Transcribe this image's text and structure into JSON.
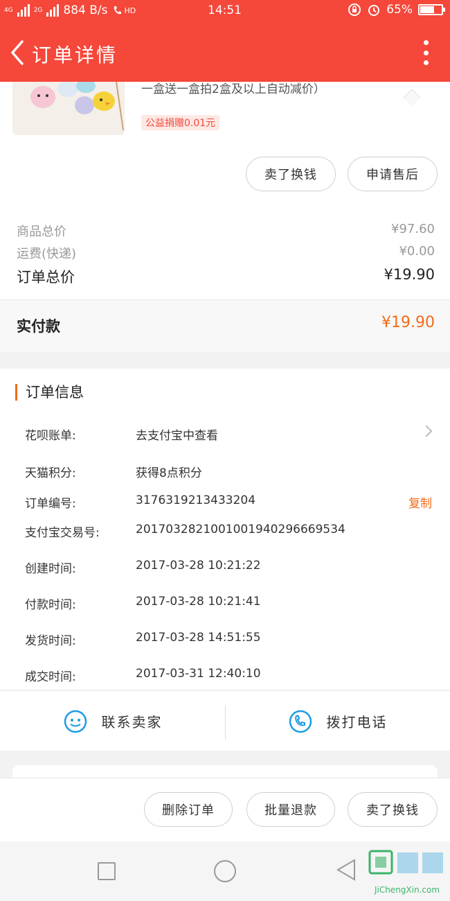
{
  "status_bar": {
    "net1": "4G",
    "net2": "2G",
    "speed": "884 B/s",
    "hd": "HD",
    "time": "14:51",
    "battery": "65%",
    "battery_level": 0.65
  },
  "header": {
    "title": "订单详情"
  },
  "product": {
    "description": "一盒送一盒拍2盒及以上自动减价）",
    "charity": "公益捐赠0.01元",
    "btn_sell": "卖了换钱",
    "btn_aftersale": "申请售后"
  },
  "prices": {
    "goods_label": "商品总价",
    "goods_value": "¥97.60",
    "shipping_label": "运费(快递)",
    "shipping_value": "¥0.00",
    "total_label": "订单总价",
    "total_value": "¥19.90",
    "paid_label": "实付款",
    "paid_value": "¥19.90"
  },
  "order_info": {
    "title": "订单信息",
    "rows": [
      {
        "label": "花呗账单:",
        "value": "去支付宝中查看"
      },
      {
        "label": "天猫积分:",
        "value": "获得8点积分"
      },
      {
        "label": "订单编号:",
        "value": "3176319213433204"
      },
      {
        "label": "支付宝交易号:",
        "value": "2017032821001001940296669534"
      },
      {
        "label": "创建时间:",
        "value": "2017-03-28 10:21:22"
      },
      {
        "label": "付款时间:",
        "value": "2017-03-28 10:21:41"
      },
      {
        "label": "发货时间:",
        "value": "2017-03-28 14:51:55"
      },
      {
        "label": "成交时间:",
        "value": "2017-03-31 12:40:10"
      }
    ],
    "copy_label": "复制"
  },
  "contact": {
    "seller": "联系卖家",
    "phone": "拨打电话"
  },
  "actions": {
    "delete": "删除订单",
    "refund": "批量退款",
    "sell": "卖了换钱"
  },
  "watermark": {
    "text": "JiChengXin.com"
  },
  "colors": {
    "header": "#f5473a",
    "accent": "#f46a1a",
    "blue": "#1a9be6"
  }
}
